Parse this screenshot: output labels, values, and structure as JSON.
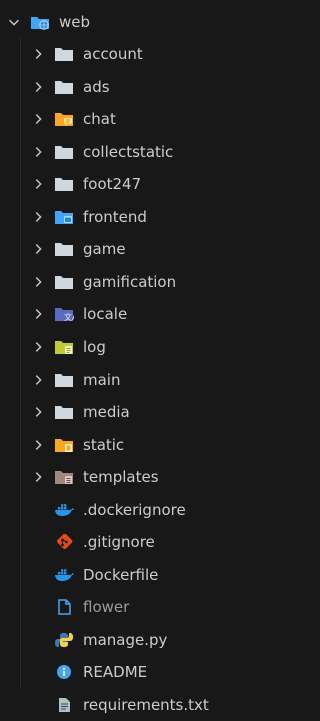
{
  "explorer": {
    "root": {
      "label": "web",
      "icon": "folder-web-icon",
      "expanded": true
    },
    "items": [
      {
        "label": "account",
        "kind": "folder",
        "icon": "folder-icon"
      },
      {
        "label": "ads",
        "kind": "folder",
        "icon": "folder-icon"
      },
      {
        "label": "chat",
        "kind": "folder",
        "icon": "folder-chat-icon"
      },
      {
        "label": "collectstatic",
        "kind": "folder",
        "icon": "folder-icon"
      },
      {
        "label": "foot247",
        "kind": "folder",
        "icon": "folder-icon"
      },
      {
        "label": "frontend",
        "kind": "folder",
        "icon": "folder-frontend-icon"
      },
      {
        "label": "game",
        "kind": "folder",
        "icon": "folder-icon"
      },
      {
        "label": "gamification",
        "kind": "folder",
        "icon": "folder-icon"
      },
      {
        "label": "locale",
        "kind": "folder",
        "icon": "folder-locale-icon"
      },
      {
        "label": "log",
        "kind": "folder",
        "icon": "folder-log-icon"
      },
      {
        "label": "main",
        "kind": "folder",
        "icon": "folder-icon"
      },
      {
        "label": "media",
        "kind": "folder",
        "icon": "folder-icon"
      },
      {
        "label": "static",
        "kind": "folder",
        "icon": "folder-static-icon"
      },
      {
        "label": "templates",
        "kind": "folder",
        "icon": "folder-templates-icon"
      },
      {
        "label": ".dockerignore",
        "kind": "file",
        "icon": "docker-icon"
      },
      {
        "label": ".gitignore",
        "kind": "file",
        "icon": "git-icon"
      },
      {
        "label": "Dockerfile",
        "kind": "file",
        "icon": "docker-icon"
      },
      {
        "label": "flower",
        "kind": "file",
        "icon": "file-icon",
        "muted": true
      },
      {
        "label": "manage.py",
        "kind": "file",
        "icon": "python-icon"
      },
      {
        "label": "README",
        "kind": "file",
        "icon": "info-icon"
      },
      {
        "label": "requirements.txt",
        "kind": "file",
        "icon": "text-file-icon"
      }
    ]
  },
  "colors": {
    "background": "#181818",
    "text": "#cccccc",
    "muted_text": "#9a9a9a",
    "folder": "#cfd8dc",
    "blue": "#42a5f5",
    "orange": "#f9a825",
    "python_blue": "#3b78b5",
    "python_yellow": "#f5d146",
    "git": "#e64a19"
  }
}
